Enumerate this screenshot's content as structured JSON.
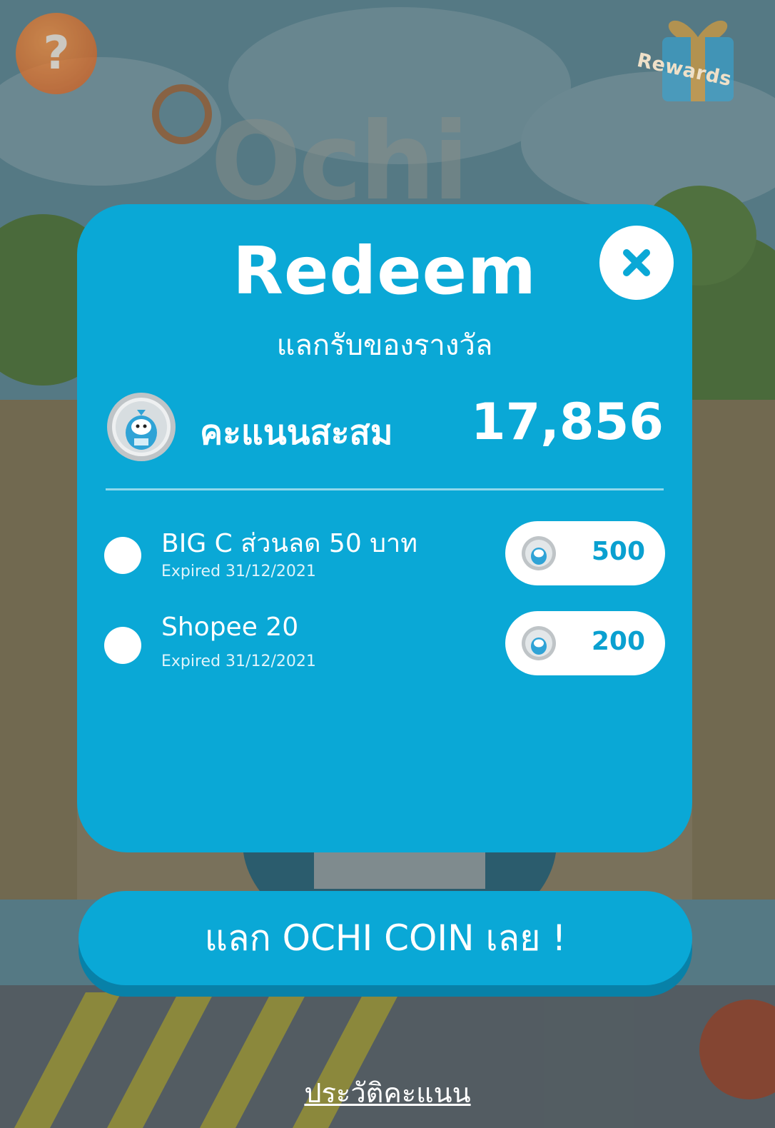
{
  "background": {
    "help_icon": "question-icon",
    "rewards_label": "Rewards",
    "logo_text": "Ochi"
  },
  "modal": {
    "title": "Redeem",
    "subtitle": "แลกรับของรางวัล",
    "close_icon": "close-icon",
    "points_label": "คะแนนสะสม",
    "points_value": "17,856",
    "rewards": [
      {
        "name": "BIG C ส่วนลด 50 บาท",
        "expiry": "Expired 31/12/2021",
        "cost": "500",
        "selected": false
      },
      {
        "name": "Shopee 20",
        "expiry": "Expired 31/12/2021",
        "cost": "200",
        "selected": false
      }
    ]
  },
  "cta": {
    "label": "แลก OCHI COIN เลย !"
  },
  "footer": {
    "history_link": "ประวัติคะแนน"
  },
  "colors": {
    "modal_bg": "#0aa8d6",
    "cta_shadow": "#0881a8",
    "cost_text": "#0aa0d0"
  }
}
